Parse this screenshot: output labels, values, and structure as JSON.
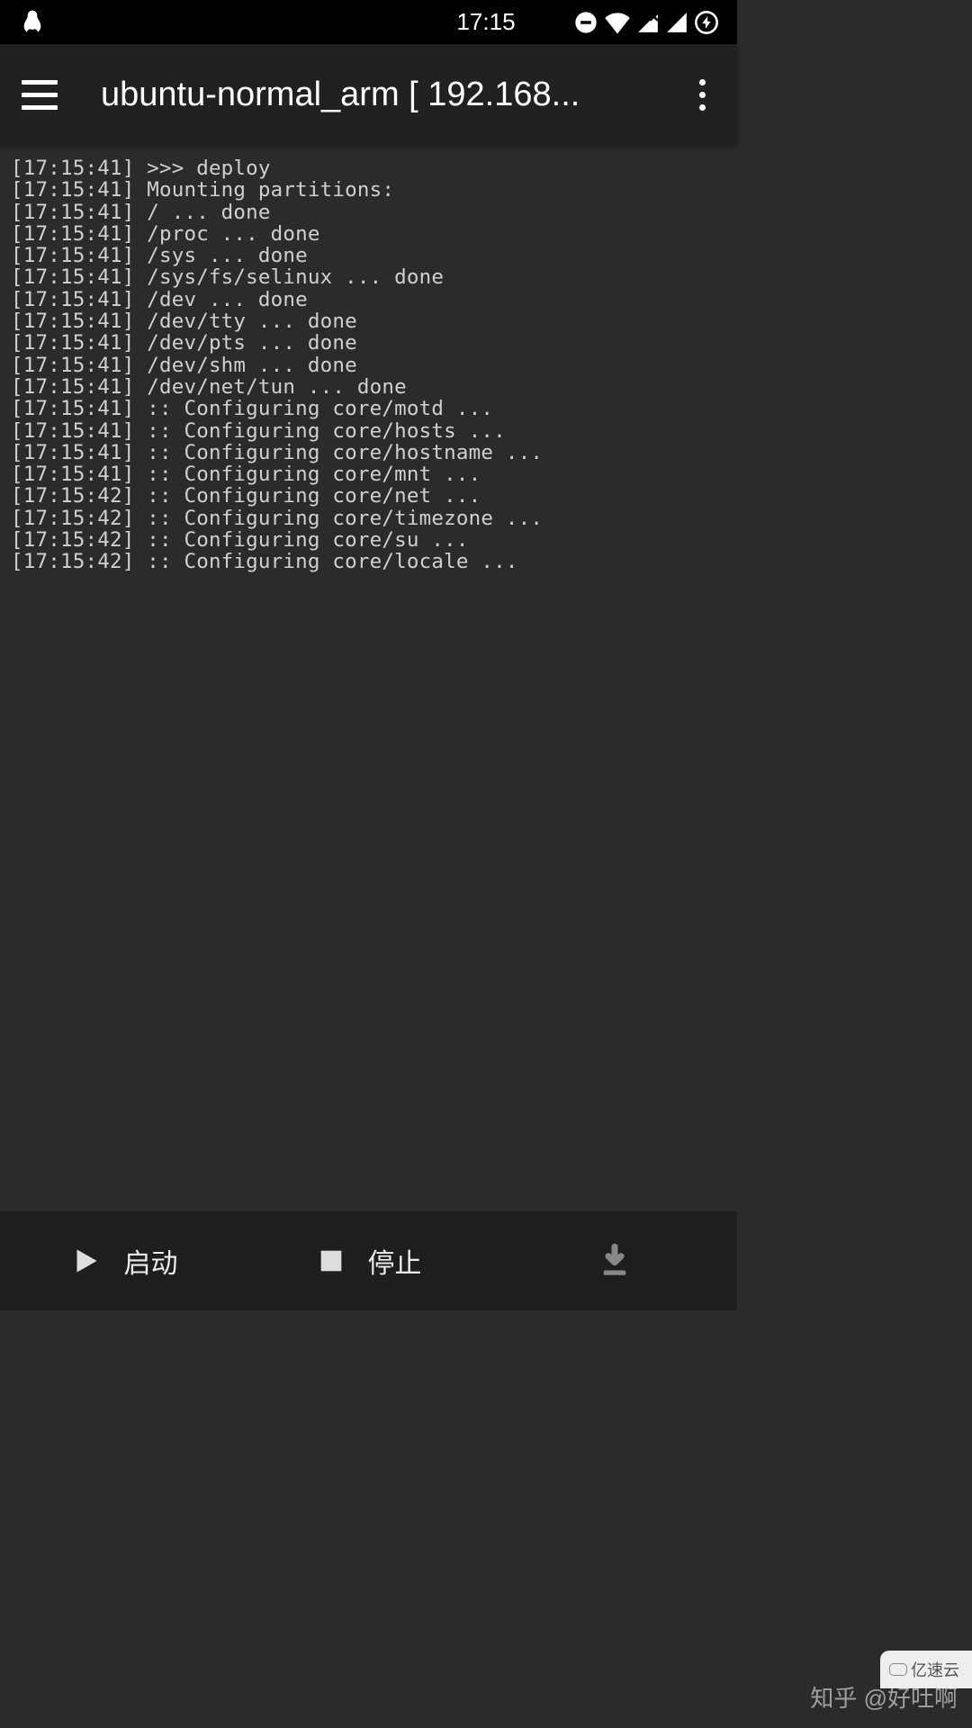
{
  "status": {
    "time": "17:15"
  },
  "appbar": {
    "title": "ubuntu-normal_arm  [ 192.168..."
  },
  "terminal": {
    "lines": [
      "[17:15:41] >>> deploy",
      "[17:15:41] Mounting partitions:",
      "[17:15:41] / ... done",
      "[17:15:41] /proc ... done",
      "[17:15:41] /sys ... done",
      "[17:15:41] /sys/fs/selinux ... done",
      "[17:15:41] /dev ... done",
      "[17:15:41] /dev/tty ... done",
      "[17:15:41] /dev/pts ... done",
      "[17:15:41] /dev/shm ... done",
      "[17:15:41] /dev/net/tun ... done",
      "[17:15:41] :: Configuring core/motd ...",
      "[17:15:41] :: Configuring core/hosts ...",
      "[17:15:41] :: Configuring core/hostname ...",
      "[17:15:41] :: Configuring core/mnt ...",
      "[17:15:42] :: Configuring core/net ...",
      "[17:15:42] :: Configuring core/timezone ...",
      "[17:15:42] :: Configuring core/su ...",
      "[17:15:42] :: Configuring core/locale ..."
    ]
  },
  "bottom": {
    "start": "启动",
    "stop": "停止"
  },
  "watermark": {
    "zhihu": "知乎 @好吐啊",
    "corner": "亿速云"
  }
}
